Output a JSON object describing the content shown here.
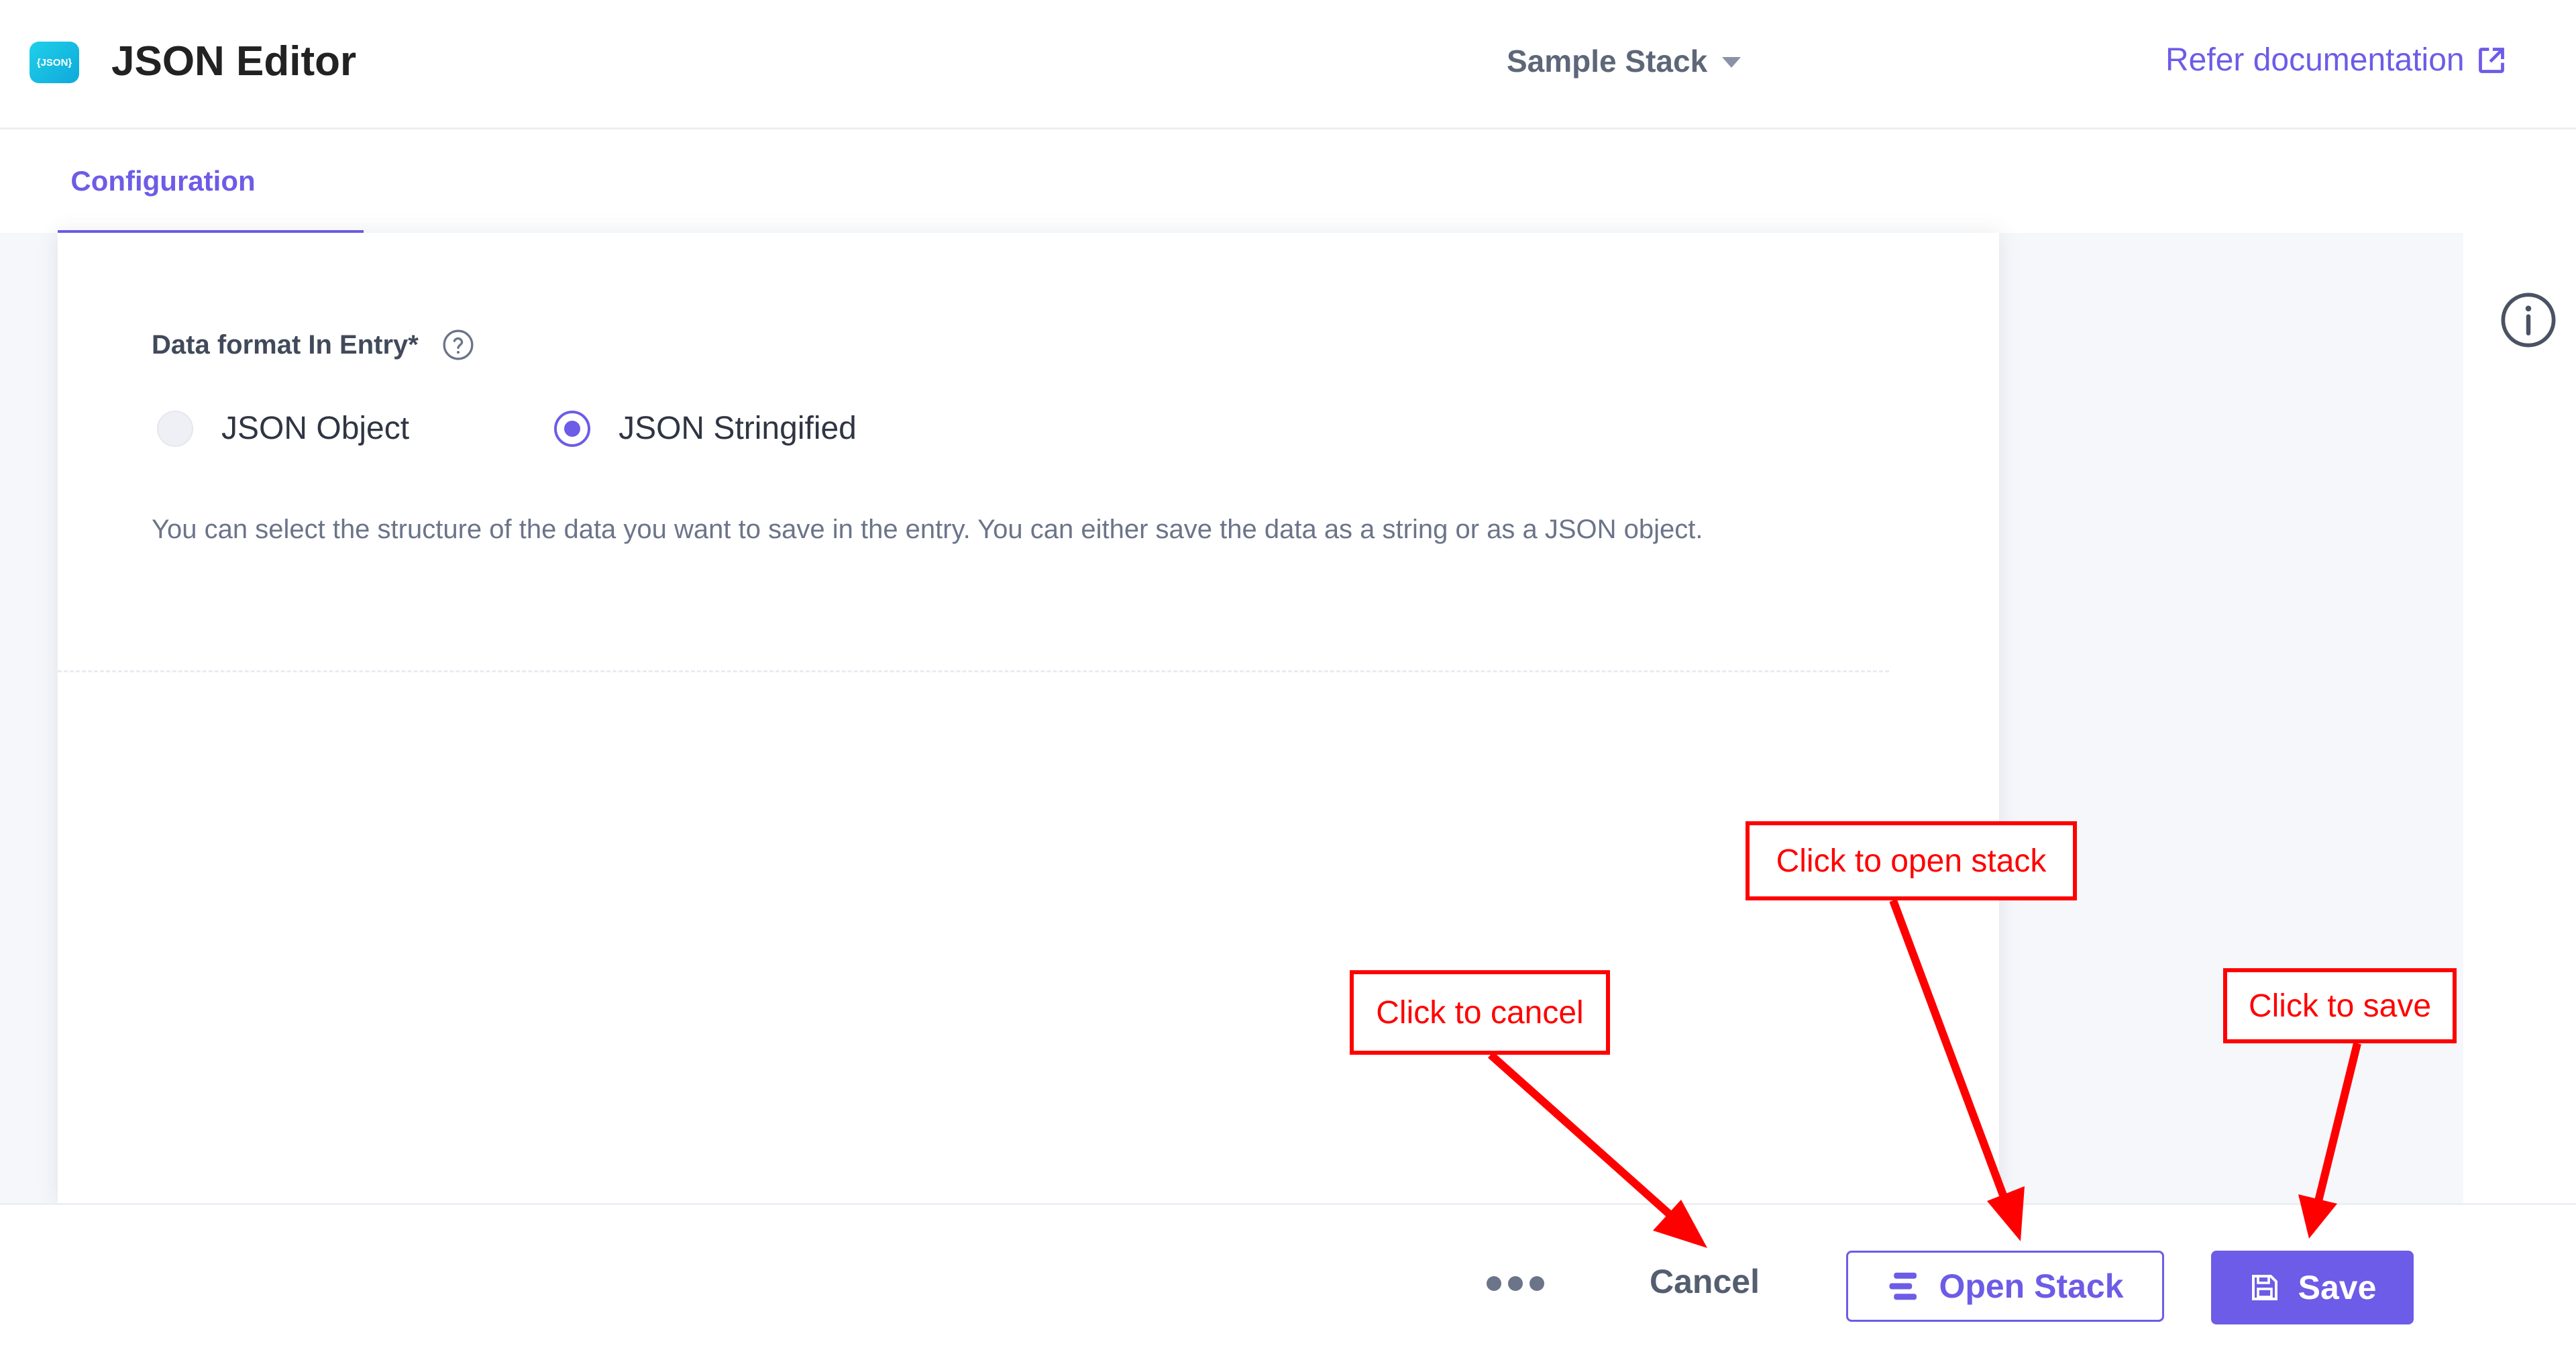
{
  "header": {
    "logo_text": "{JSON}",
    "title": "JSON Editor",
    "stack_name": "Sample Stack",
    "doc_link": "Refer documentation"
  },
  "tabs": [
    {
      "label": "Configuration",
      "active": true
    }
  ],
  "config": {
    "field_label": "Data format In Entry*",
    "options": [
      {
        "label": "JSON Object",
        "selected": false
      },
      {
        "label": "JSON Stringified",
        "selected": true
      }
    ],
    "help_text": "You can select the structure of the data you want to save in the entry. You can either save the data as a string or as a JSON object."
  },
  "footer": {
    "cancel_label": "Cancel",
    "open_stack_label": "Open Stack",
    "save_label": "Save"
  },
  "annotations": {
    "cancel": "Click to cancel",
    "open_stack": "Click to open stack",
    "save": "Click to save"
  },
  "colors": {
    "accent": "#6c5ce7",
    "annotation": "#ff0000",
    "logo": "#15c0e3"
  },
  "icons": [
    "json-logo-icon",
    "caret-down-icon",
    "external-link-icon",
    "help-circle-icon",
    "info-icon",
    "more-dots-icon",
    "stack-icon",
    "floppy-disk-icon"
  ]
}
